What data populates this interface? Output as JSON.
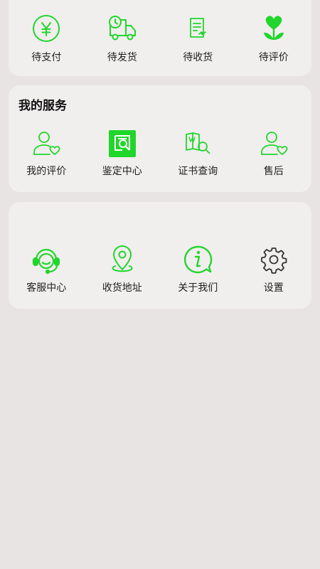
{
  "orders": {
    "items": [
      {
        "label": "待支付",
        "icon": "yen-circle-icon"
      },
      {
        "label": "待发货",
        "icon": "delivery-truck-icon"
      },
      {
        "label": "待收货",
        "icon": "receipt-icon"
      },
      {
        "label": "待评价",
        "icon": "heart-flower-icon"
      }
    ]
  },
  "services": {
    "title": "我的服务",
    "items": [
      {
        "label": "我的评价",
        "icon": "user-heart-icon"
      },
      {
        "label": "鉴定中心",
        "icon": "appraisal-scan-icon"
      },
      {
        "label": "证书查询",
        "icon": "certificate-search-icon"
      },
      {
        "label": "售后",
        "icon": "user-heart-icon"
      }
    ]
  },
  "more": {
    "items": [
      {
        "label": "客服中心",
        "icon": "customer-service-icon"
      },
      {
        "label": "收货地址",
        "icon": "location-pin-icon"
      },
      {
        "label": "关于我们",
        "icon": "info-bubble-icon"
      },
      {
        "label": "设置",
        "icon": "gear-icon"
      }
    ]
  },
  "colors": {
    "accent": "#21d62b",
    "background": "#e9e4e4",
    "card": "#f1eeee"
  }
}
